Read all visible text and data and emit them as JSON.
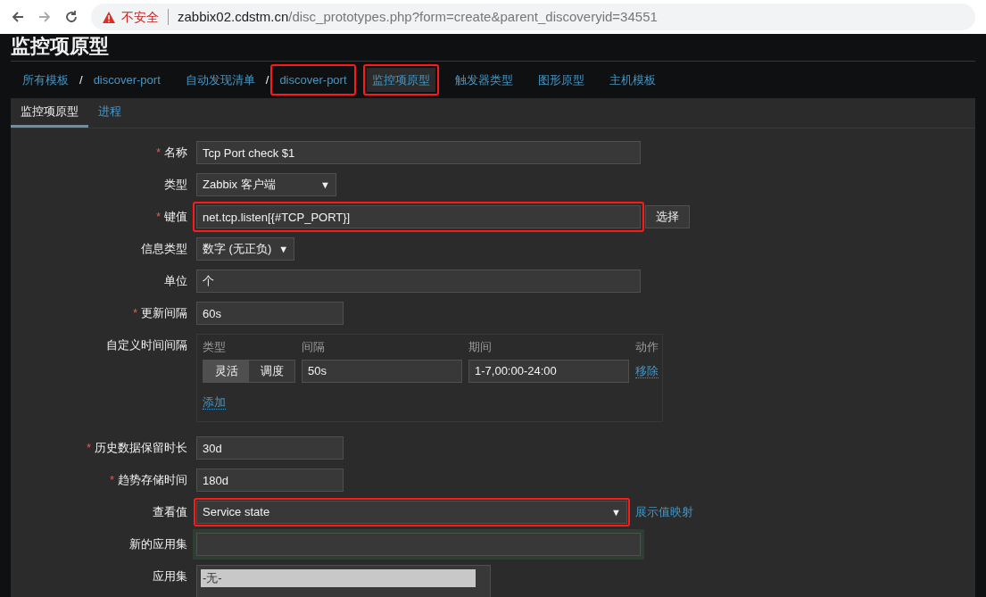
{
  "browser": {
    "security_label": "不安全",
    "url_host": "zabbix02.cdstm.cn",
    "url_path": "/disc_prototypes.php?form=create&parent_discoveryid=34551"
  },
  "page_title": "监控项原型",
  "breadcrumbs": [
    {
      "label": "所有模板",
      "separator": "/",
      "selected": false,
      "highlighted": false
    },
    {
      "label": "discover-port",
      "selected": false,
      "highlighted": false
    },
    {
      "label": "自动发现清单",
      "separator": "/",
      "selected": false,
      "highlighted": false
    },
    {
      "label": "discover-port",
      "selected": false,
      "highlighted": true
    },
    {
      "label": "监控项原型",
      "selected": true,
      "highlighted": true
    },
    {
      "label": "触发器类型",
      "selected": false,
      "highlighted": false
    },
    {
      "label": "图形原型",
      "selected": false,
      "highlighted": false
    },
    {
      "label": "主机模板",
      "selected": false,
      "highlighted": false
    }
  ],
  "tabs": [
    {
      "label": "监控项原型",
      "selected": true
    },
    {
      "label": "进程",
      "selected": false
    }
  ],
  "form": [
    {
      "kind": "text",
      "label": "名称",
      "required_mark": "*",
      "value": "Tcp Port check $1",
      "highlighted": false
    },
    {
      "kind": "select",
      "label": "类型",
      "value": "Zabbix 客户端",
      "arrow": "▼",
      "highlighted": false
    },
    {
      "kind": "text",
      "label": "键值",
      "required_mark": "*",
      "value": "net.tcp.listen[{#TCP_PORT}]",
      "button": "选择",
      "highlighted": true
    },
    {
      "kind": "select",
      "label": "信息类型",
      "value": "数字 (无正负)",
      "arrow": "▼",
      "highlighted": false
    },
    {
      "kind": "text",
      "label": "单位",
      "value": "个",
      "highlighted": false
    },
    {
      "kind": "text",
      "label": "更新间隔",
      "required_mark": "*",
      "value": "60s",
      "highlighted": false
    },
    {
      "kind": "intervals",
      "label": "自定义时间间隔",
      "headers": [
        "类型",
        "间隔",
        "期间",
        "动作"
      ],
      "rows": [
        {
          "modes": [
            {
              "label": "灵活",
              "selected": true
            },
            {
              "label": "调度",
              "selected": false
            }
          ],
          "interval": "50s",
          "period": "1-7,00:00-24:00",
          "action": "移除"
        }
      ],
      "add": "添加"
    },
    {
      "kind": "text",
      "label": "历史数据保留时长",
      "required_mark": "*",
      "value": "30d",
      "highlighted": false
    },
    {
      "kind": "text",
      "label": "趋势存储时间",
      "required_mark": "*",
      "value": "180d",
      "highlighted": false
    },
    {
      "kind": "select",
      "label": "查看值",
      "value": "Service state",
      "arrow": "▼",
      "link": "展示值映射",
      "highlighted": true
    },
    {
      "kind": "text",
      "label": "新的应用集",
      "highlighted": false
    },
    {
      "kind": "list",
      "label": "应用集",
      "items": [
        {
          "label": "-无-",
          "selected": true
        }
      ]
    }
  ]
}
